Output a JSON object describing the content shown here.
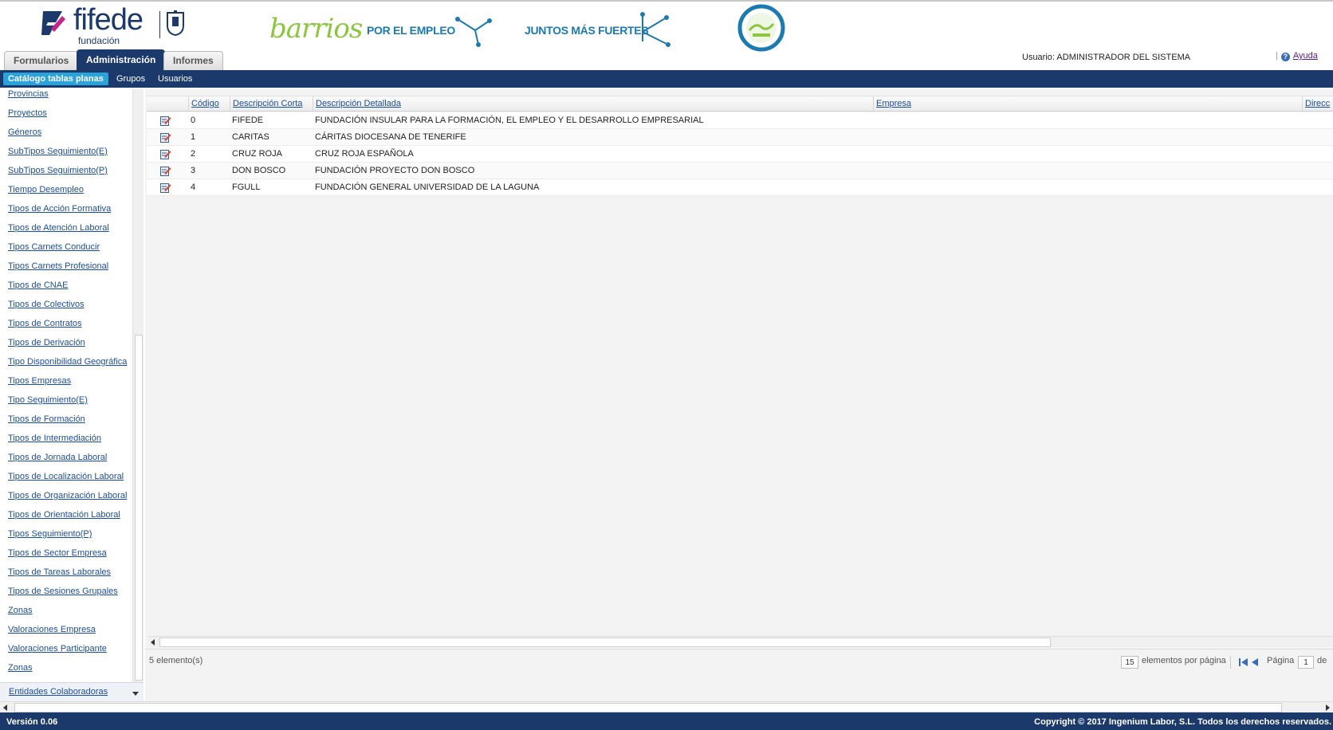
{
  "header": {
    "logo": {
      "brand": "fifede",
      "brand_sub": "fundación"
    },
    "banner": {
      "barrios": "barrios",
      "slogan_1": "POR EL EMPLEO",
      "slogan_2": "JUNTOS MÁS FUERTES"
    },
    "tabs": [
      {
        "label": "Formularios",
        "active": false
      },
      {
        "label": "Administración",
        "active": true
      },
      {
        "label": "Informes",
        "active": false
      }
    ],
    "user_info": "Usuario: ADMINISTRADOR DEL SISTEMA",
    "help_label": "Ayuda",
    "help_separator": "|"
  },
  "navbar": {
    "items": [
      {
        "label": "Catálogo tablas planas",
        "active": true
      },
      {
        "label": "Grupos",
        "active": false
      },
      {
        "label": "Usuarios",
        "active": false
      }
    ]
  },
  "sidebar": {
    "items": [
      "Provincias",
      "Proyectos",
      "Géneros",
      "SubTipos Seguimiento(E)",
      "SubTipos Seguimiento(P)",
      "Tiempo Desempleo",
      "Tipos de Acción Formativa",
      "Tipos de Atención Laboral",
      "Tipos Carnets Conducir",
      "Tipos Carnets Profesional",
      "Tipos de CNAE",
      "Tipos de Colectivos",
      "Tipos de Contratos",
      "Tipos de Derivación",
      "Tipo Disponibilidad Geográfica",
      "Tipos Empresas",
      "Tipo Seguimiento(E)",
      "Tipos de Formación",
      "Tipos de Intermediación",
      "Tipos de Jornada Laboral",
      "Tipos de Localización Laboral",
      "Tipos de Organización Laboral",
      "Tipos de Orientación Laboral",
      "Tipos Seguimiento(P)",
      "Tipos de Sector Empresa",
      "Tipos de Tareas Laborales",
      "Tipos de Sesiones Grupales",
      "Zonas",
      "Valoraciones Empresa",
      "Valoraciones Participante",
      "Zonas"
    ],
    "bottom_select": "Entidades Colaboradoras"
  },
  "grid": {
    "columns": [
      "Código",
      "Descripción Corta",
      "Descripción Detallada",
      "Empresa",
      "Direcc"
    ],
    "rows": [
      {
        "codigo": "0",
        "corta": "FIFEDE",
        "detallada": "FUNDACIÓN INSULAR PARA LA FORMACIÓN, EL EMPLEO Y EL DESARROLLO EMPRESARIAL",
        "empresa": ""
      },
      {
        "codigo": "1",
        "corta": "CARITAS",
        "detallada": "CÁRITAS DIOCESANA DE TENERIFE",
        "empresa": ""
      },
      {
        "codigo": "2",
        "corta": "CRUZ ROJA",
        "detallada": "CRUZ ROJA ESPAÑOLA",
        "empresa": ""
      },
      {
        "codigo": "3",
        "corta": "DON BOSCO",
        "detallada": "FUNDACIÓN PROYECTO DON BOSCO",
        "empresa": ""
      },
      {
        "codigo": "4",
        "corta": "FGULL",
        "detallada": "FUNDACIÓN GENERAL UNIVERSIDAD DE LA LAGUNA",
        "empresa": ""
      }
    ]
  },
  "pager": {
    "count": "5 elemento(s)",
    "per_page_value": "15",
    "per_page_label": "elementos por página",
    "page_label": "Página",
    "page_value": "1",
    "of_label": "de"
  },
  "footer": {
    "version": "Versión 0.06",
    "copyright": "Copyright © 2017 Ingenium Labor, S.L. Todos los derechos reservados."
  },
  "colors": {
    "primary": "#1b3a6b",
    "accent": "#2aa3db",
    "link": "#1a4fa0",
    "barrios_green": "#8cc63f",
    "banner_blue": "#1b7bb0"
  },
  "icons": {
    "row_edit": "edit-pencil-icon",
    "help": "help-icon",
    "pager_first": "first-page-icon",
    "pager_prev": "prev-page-icon"
  }
}
